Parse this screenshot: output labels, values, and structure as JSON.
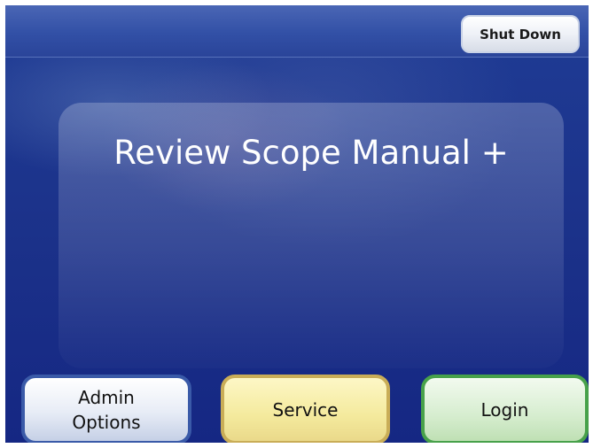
{
  "header": {
    "shutdown_label": "Shut Down"
  },
  "main": {
    "title": "Review Scope Manual +"
  },
  "footer": {
    "admin_line1": "Admin",
    "admin_line2": "Options",
    "service_label": "Service",
    "login_label": "Login"
  },
  "colors": {
    "background": "#1b3189",
    "admin_border": "#3a5aa8",
    "service_border": "#c9ad57",
    "login_border": "#47a14a"
  }
}
